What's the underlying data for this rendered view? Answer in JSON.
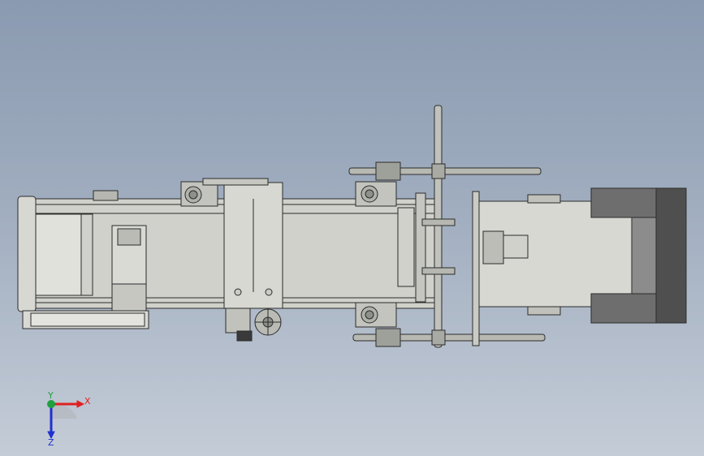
{
  "viewport": {
    "background_top": "#8a9ab0",
    "background_bottom": "#c4ccd7"
  },
  "model": {
    "view": "top",
    "part_fill": "#c9cbc4",
    "part_edge": "#2c2c2c",
    "dark_block": "#5b5b5b"
  },
  "triad": {
    "x_label": "X",
    "y_label": "Y",
    "z_label": "Z",
    "x_color": "#e02020",
    "z_color": "#2030d0",
    "y_color": "#20a040"
  }
}
